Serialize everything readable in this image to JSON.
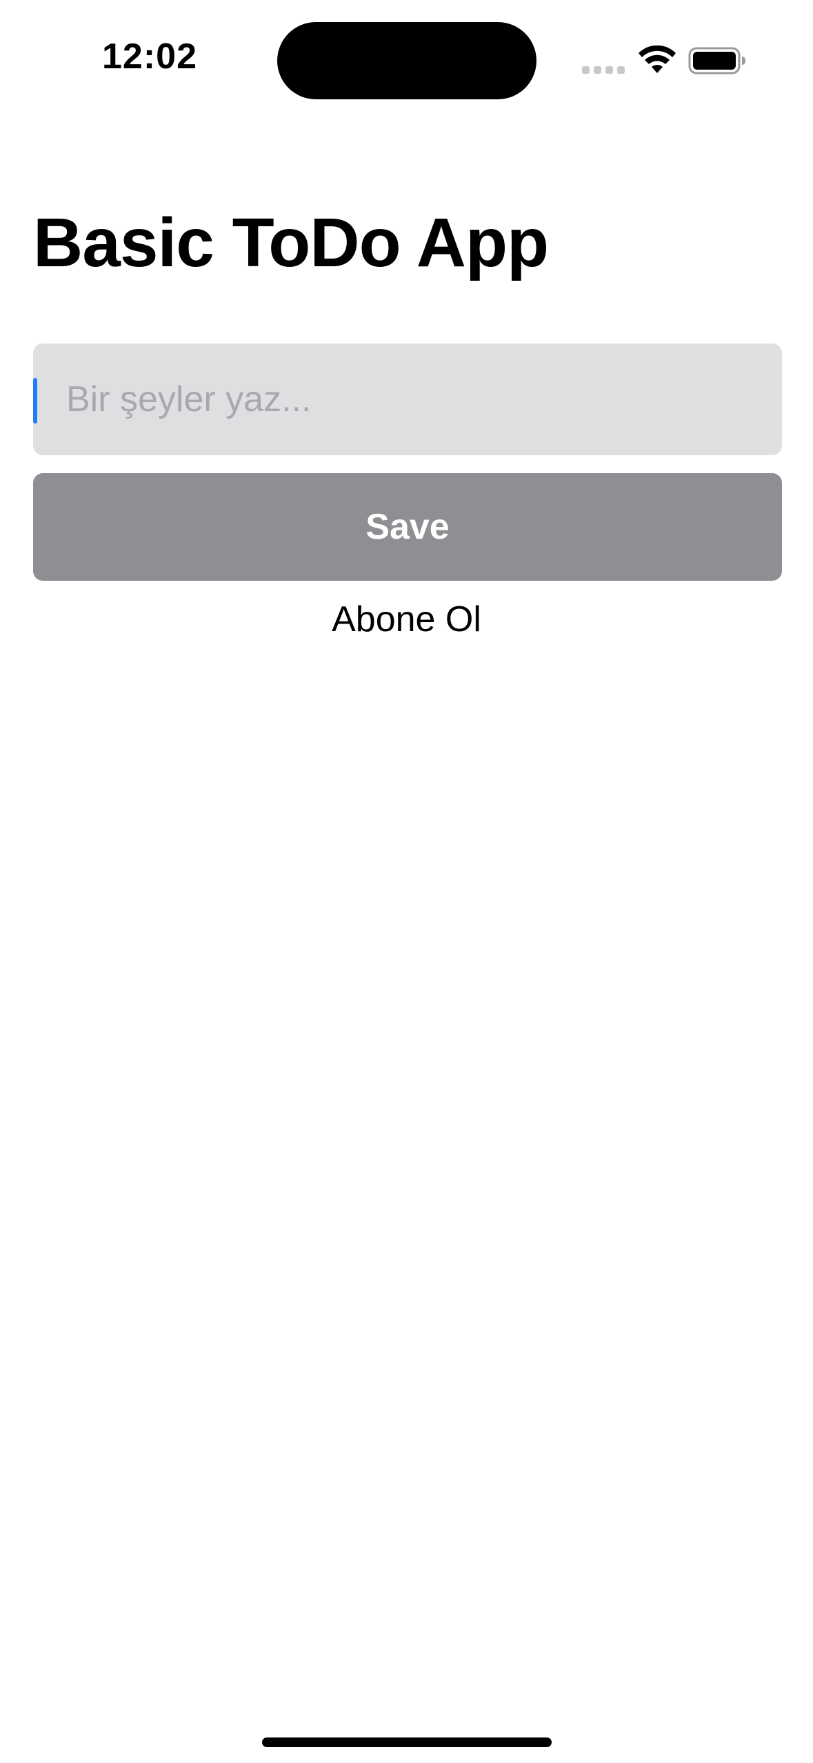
{
  "status_bar": {
    "time": "12:02",
    "icons": [
      "cellular-signal-icon",
      "wifi-icon",
      "battery-icon"
    ]
  },
  "page": {
    "title": "Basic ToDo App"
  },
  "todo_input": {
    "value": "",
    "placeholder": "Bir şeyler yaz..."
  },
  "save_button": {
    "label": "Save"
  },
  "subscribe": {
    "label": "Abone Ol"
  },
  "colors": {
    "input_background": "#dfdfe1",
    "button_background": "#8e8e93",
    "cursor": "#1f7cf4",
    "placeholder": "#a9a9ad"
  }
}
